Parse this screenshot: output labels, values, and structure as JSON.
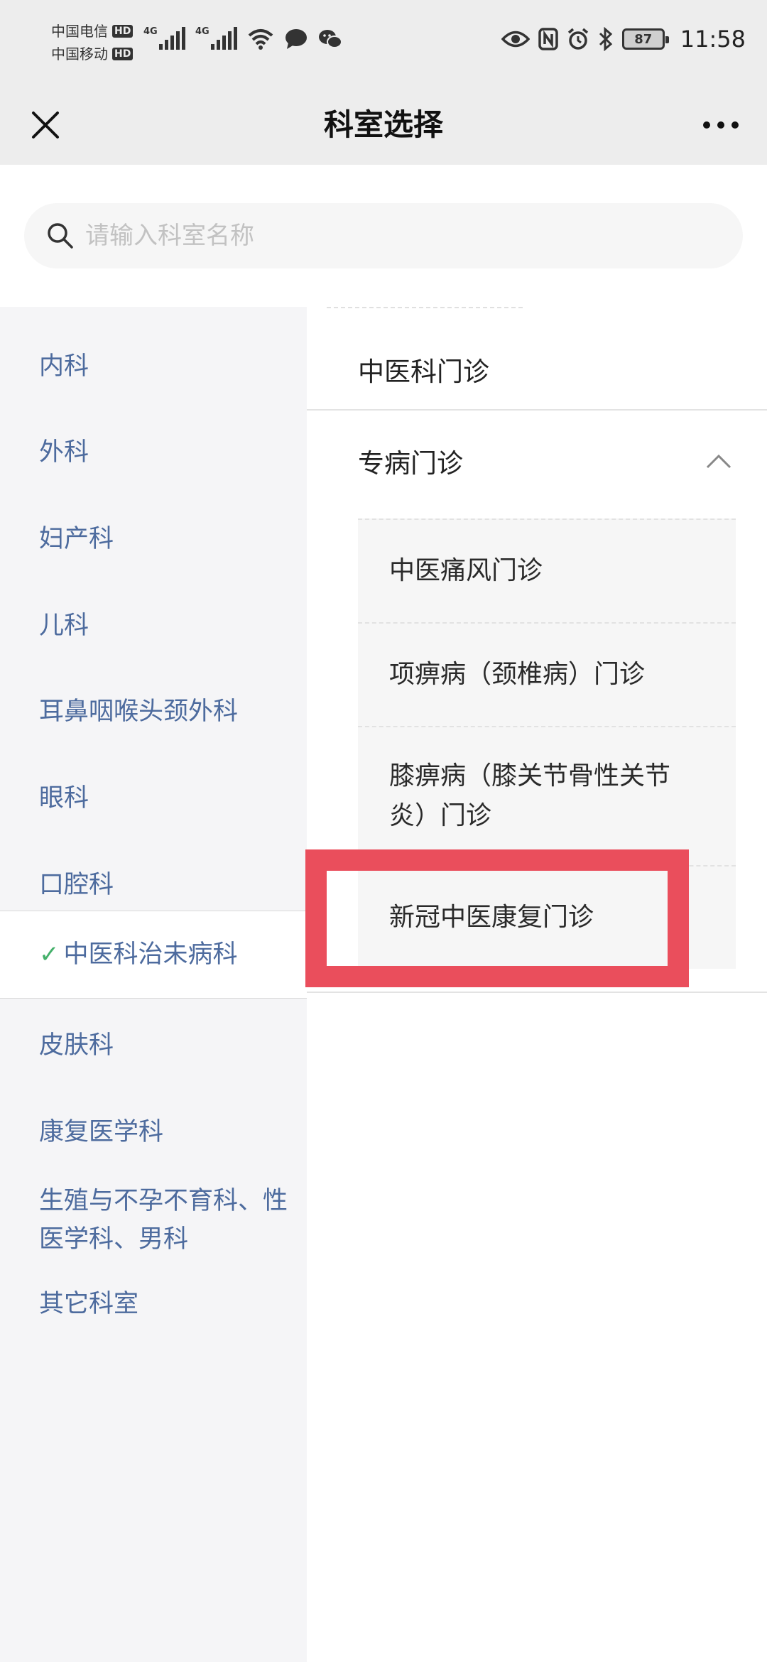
{
  "status_bar": {
    "carrier_1": "中国电信",
    "carrier_2": "中国移动",
    "hd_badge": "HD",
    "network_1": "4G",
    "network_2": "4G",
    "battery": "87",
    "time": "11:58"
  },
  "nav": {
    "title": "科室选择"
  },
  "search": {
    "placeholder": "请输入科室名称"
  },
  "categories": [
    {
      "label": "内科"
    },
    {
      "label": "外科"
    },
    {
      "label": "妇产科"
    },
    {
      "label": "儿科"
    },
    {
      "label": "耳鼻咽喉头颈外科"
    },
    {
      "label": "眼科"
    },
    {
      "label": "口腔科"
    },
    {
      "label": "中医科治未病科",
      "selected": true
    },
    {
      "label": "皮肤科"
    },
    {
      "label": "康复医学科"
    },
    {
      "label": "生殖与不孕不育科、性医学科、男科"
    },
    {
      "label": "其它科室"
    }
  ],
  "departments": {
    "item_1": "中医科门诊",
    "group_label": "专病门诊",
    "group_expanded": true,
    "sub_items": [
      {
        "label": "中医痛风门诊"
      },
      {
        "label": "项痹病（颈椎病）门诊"
      },
      {
        "label": "膝痹病（膝关节骨性关节炎）门诊"
      },
      {
        "label": "新冠中医康复门诊"
      }
    ]
  },
  "colors": {
    "category_text": "#4d6b9e",
    "check": "#44b06a",
    "highlight": "#ea4e5c",
    "sidebar_bg": "#f5f5f7"
  }
}
